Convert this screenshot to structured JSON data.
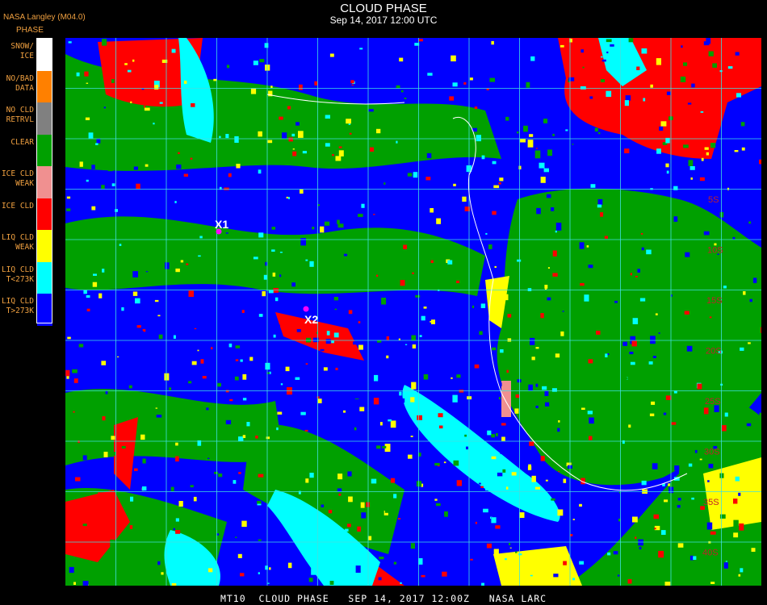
{
  "header": {
    "source": "NASA Langley (M04.0)",
    "phase_label": "PHASE",
    "title": "CLOUD PHASE",
    "subtitle": "Sep 14, 2017 12:00 UTC"
  },
  "legend": [
    {
      "label": "SNOW/\nICE",
      "color": "#ffffff"
    },
    {
      "label": "NO/BAD\nDATA",
      "color": "#ff8000"
    },
    {
      "label": "NO CLD\nRETRVL",
      "color": "#808080"
    },
    {
      "label": "CLEAR",
      "color": "#00a000"
    },
    {
      "label": "ICE CLD\nWEAK",
      "color": "#f09090"
    },
    {
      "label": "ICE CLD",
      "color": "#ff0000"
    },
    {
      "label": "LIQ CLD\nWEAK",
      "color": "#ffff00"
    },
    {
      "label": "LIQ CLD\nT<273K",
      "color": "#00ffff"
    },
    {
      "label": "LIQ CLD\nT>273K",
      "color": "#0000ff"
    }
  ],
  "markers": [
    {
      "label": "X1"
    },
    {
      "label": "X2"
    }
  ],
  "grid_labels": [
    "5S",
    "10S",
    "15S",
    "20S",
    "25S",
    "30S",
    "35S",
    "40S"
  ],
  "footer": "MT10  CLOUD PHASE   SEP 14, 2017 12:00Z   NASA LARC"
}
